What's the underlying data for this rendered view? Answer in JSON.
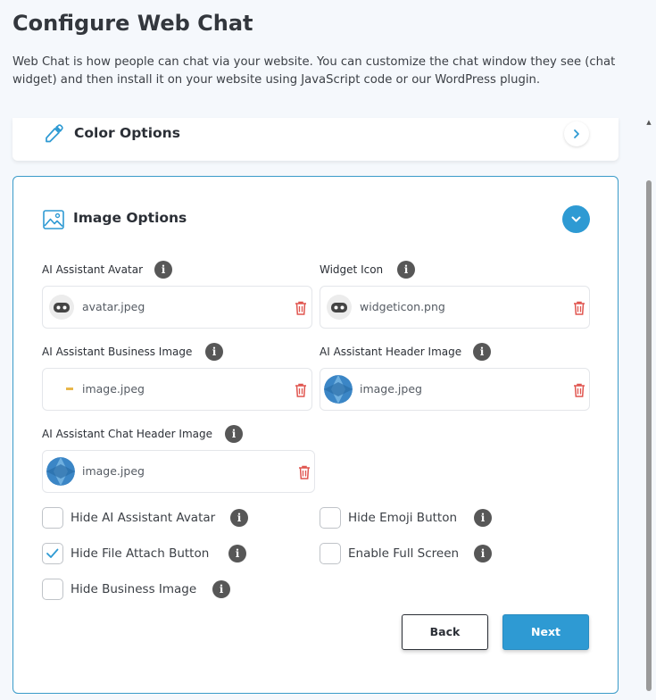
{
  "header": {
    "title": "Configure Web Chat",
    "description": "Web Chat is how people can chat via your website. You can customize the chat window they see (chat widget) and then install it on your website using JavaScript code or our WordPress plugin."
  },
  "color_section": {
    "title": "Color Options",
    "icon": "eyedropper-icon"
  },
  "image_section": {
    "title": "Image Options",
    "icon": "image-icon",
    "fields": {
      "ai_avatar": {
        "label": "AI Assistant Avatar",
        "file": "avatar.jpeg",
        "thumb": "robot-icon"
      },
      "widget_icon": {
        "label": "Widget Icon",
        "file": "widgeticon.png",
        "thumb": "robot-icon"
      },
      "business_image": {
        "label": "AI Assistant Business Image",
        "file": "image.jpeg",
        "thumb": "small-logo"
      },
      "header_image": {
        "label": "AI Assistant Header Image",
        "file": "image.jpeg",
        "thumb": "blue-globe"
      },
      "chat_header_image": {
        "label": "AI Assistant Chat Header Image",
        "file": "image.jpeg",
        "thumb": "blue-globe"
      }
    },
    "info_glyph": "i",
    "checkboxes": {
      "hide_avatar": {
        "label": "Hide AI Assistant Avatar",
        "checked": false
      },
      "hide_emoji": {
        "label": "Hide Emoji Button",
        "checked": false
      },
      "hide_file_attach": {
        "label": "Hide File Attach Button",
        "checked": true
      },
      "enable_full_screen": {
        "label": "Enable Full Screen",
        "checked": false
      },
      "hide_business_image": {
        "label": "Hide Business Image",
        "checked": false
      }
    },
    "buttons": {
      "back": "Back",
      "next": "Next"
    }
  },
  "colors": {
    "accent": "#2e9ad3",
    "trash": "#e0554f",
    "card_border": "#3a9bc9"
  }
}
